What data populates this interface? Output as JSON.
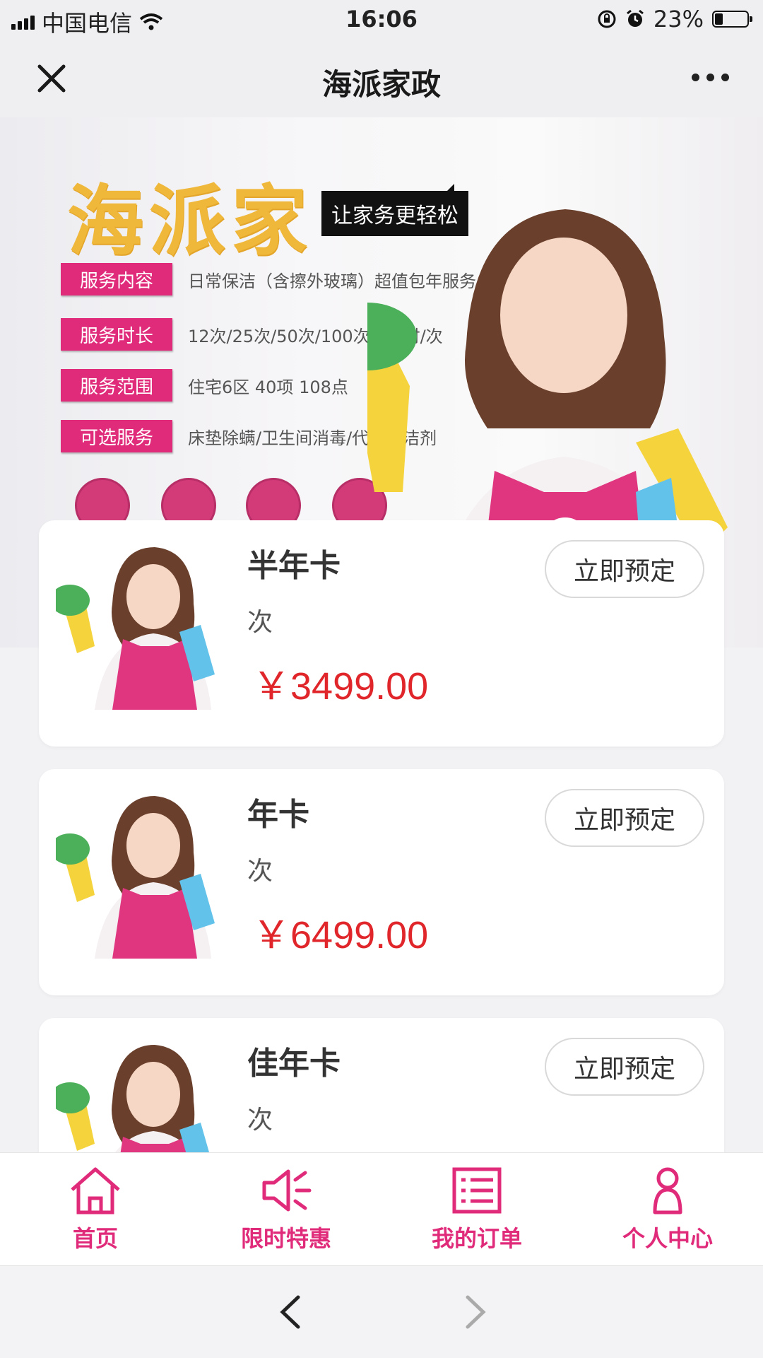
{
  "status_bar": {
    "carrier": "中国电信",
    "time": "16:06",
    "battery": "23%",
    "battery_level": 0.23
  },
  "nav": {
    "title": "海派家政"
  },
  "banner": {
    "brand": "海派家",
    "slogan": "让家务更轻松",
    "rows": [
      {
        "tag": "服务内容",
        "text": "日常保洁（含擦外玻璃）超值包年服务"
      },
      {
        "tag": "服务时长",
        "text": "12次/25次/50次/100次 4小时/次"
      },
      {
        "tag": "服务范围",
        "text": "住宅6区 40项 108点"
      },
      {
        "tag": "可选服务",
        "text": "床垫除螨/卫生间消毒/代购清洁剂"
      }
    ]
  },
  "products": [
    {
      "name": "半年卡",
      "unit": "次",
      "price": "￥3499.00",
      "button": "立即预定"
    },
    {
      "name": "年卡",
      "unit": "次",
      "price": "￥6499.00",
      "button": "立即预定"
    },
    {
      "name": "佳年卡",
      "unit": "次",
      "price": "",
      "button": "立即预定"
    }
  ],
  "tabbar": {
    "items": [
      {
        "label": "首页",
        "icon": "home-icon"
      },
      {
        "label": "限时特惠",
        "icon": "megaphone-icon"
      },
      {
        "label": "我的订单",
        "icon": "list-icon"
      },
      {
        "label": "个人中心",
        "icon": "person-icon"
      }
    ]
  },
  "colors": {
    "accent": "#e02a7a",
    "price": "#e0262a",
    "brand_yellow": "#f0b83a"
  }
}
